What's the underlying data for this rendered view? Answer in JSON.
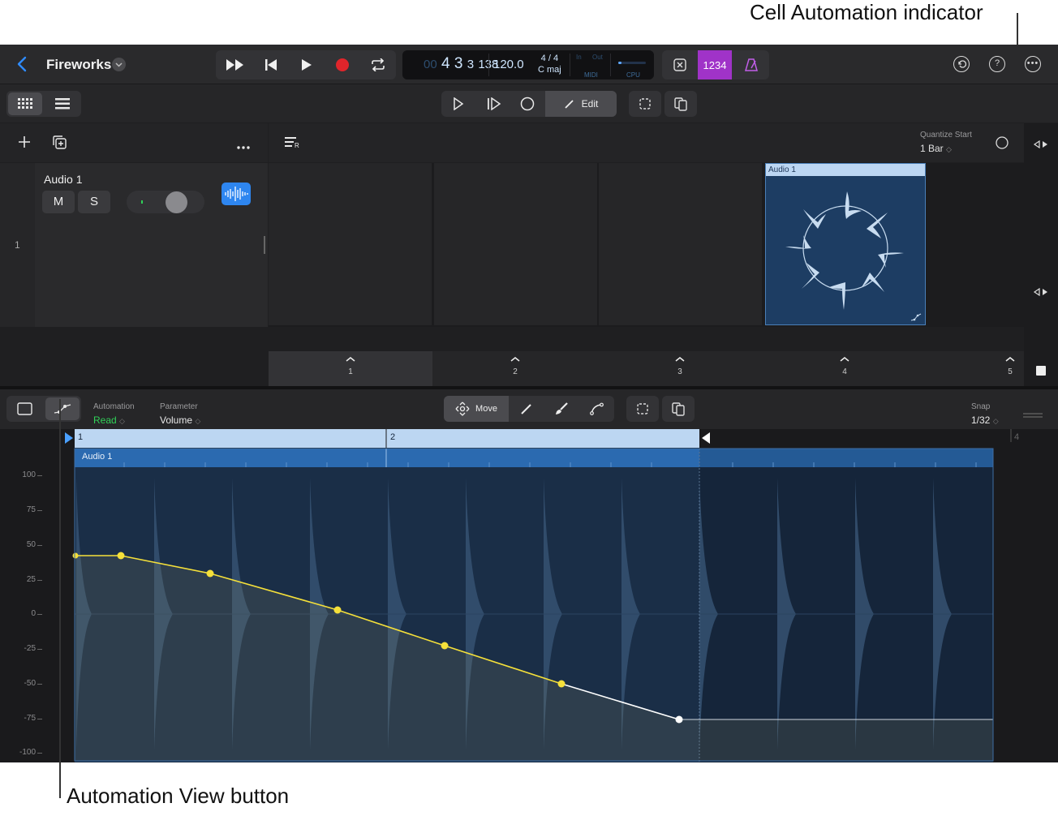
{
  "callouts": {
    "cell_automation": "Cell Automation indicator",
    "automation_view": "Automation View button"
  },
  "header": {
    "project_title": "Fireworks"
  },
  "lcd": {
    "position_dim": "00",
    "bar": "4",
    "beat": "3",
    "division": "3",
    "tick": "138",
    "tempo": "120.0",
    "time_signature": "4 / 4",
    "key": "C maj",
    "midi_label": "MIDI",
    "in_label": "In",
    "out_label": "Out",
    "cpu_label": "CPU"
  },
  "mode_controls": {
    "count_in_label": "1234"
  },
  "live_controls": {
    "edit_label": "Edit"
  },
  "quantize": {
    "label": "Quantize Start",
    "value": "1 Bar"
  },
  "track": {
    "number": "1",
    "name": "Audio 1",
    "mute_label": "M",
    "solo_label": "S"
  },
  "live_cell": {
    "name": "Audio 1"
  },
  "scenes": [
    "1",
    "2",
    "3",
    "4",
    "5"
  ],
  "automation_bar": {
    "automation_label": "Automation",
    "automation_value": "Read",
    "parameter_label": "Parameter",
    "parameter_value": "Volume",
    "move_label": "Move",
    "snap_label": "Snap",
    "snap_value": "1/32"
  },
  "editor": {
    "ruler": [
      "1",
      "2",
      "4"
    ],
    "region_name": "Audio 1",
    "y_axis": [
      "100",
      "75",
      "50",
      "25",
      "0",
      "-25",
      "-50",
      "-75",
      "-100"
    ]
  },
  "colors": {
    "accent_blue": "#2f8cff",
    "record_red": "#e0252b",
    "count_in_purple": "#a033c8",
    "automation_yellow": "#f5e03a",
    "read_green": "#30d158",
    "cell_blue": "#1d3d63"
  }
}
